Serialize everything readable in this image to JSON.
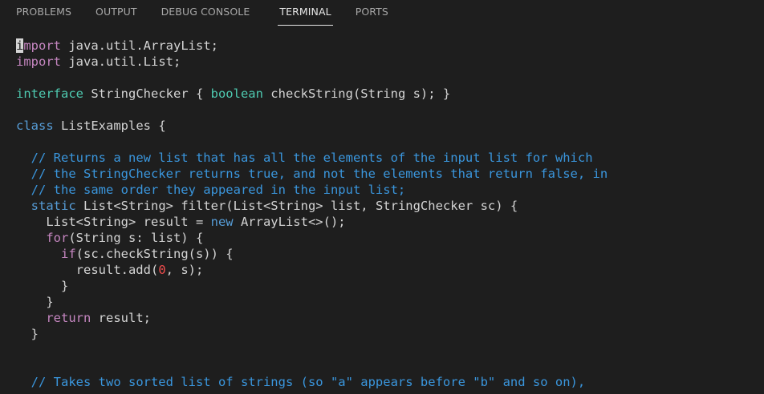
{
  "panel": {
    "tabs": [
      {
        "label": "PROBLEMS"
      },
      {
        "label": "OUTPUT"
      },
      {
        "label": "DEBUG CONSOLE"
      },
      {
        "label": "TERMINAL",
        "active": true
      },
      {
        "label": "PORTS"
      }
    ]
  },
  "colors": {
    "background": "#1e1e1e",
    "text": "#d4d4d4",
    "import_keyword": "#c586c0",
    "keyword": "#569cd6",
    "boolean_keyword": "#4ec9b0",
    "comment": "#3a96dd",
    "number": "#f14c4c"
  },
  "terminal": {
    "lines": [
      [
        {
          "t": "i",
          "c": "cursor"
        },
        {
          "t": "mport",
          "c": "kw"
        },
        {
          "t": " java.util.ArrayList;"
        }
      ],
      [
        {
          "t": "import",
          "c": "kw"
        },
        {
          "t": " java.util.List;"
        }
      ],
      [],
      [
        {
          "t": "interface",
          "c": "kw3"
        },
        {
          "t": " StringChecker { "
        },
        {
          "t": "boolean",
          "c": "kw3"
        },
        {
          "t": " checkString(String s); }"
        }
      ],
      [],
      [
        {
          "t": "class",
          "c": "kw2"
        },
        {
          "t": " ListExamples {"
        }
      ],
      [],
      [
        {
          "t": "  "
        },
        {
          "t": "// Returns a new list that has all the elements of the input list for which",
          "c": "cm"
        }
      ],
      [
        {
          "t": "  "
        },
        {
          "t": "// the StringChecker returns true, and not the elements that return false, in",
          "c": "cm"
        }
      ],
      [
        {
          "t": "  "
        },
        {
          "t": "// the same order they appeared in the input list;",
          "c": "cm"
        }
      ],
      [
        {
          "t": "  "
        },
        {
          "t": "static",
          "c": "kw2"
        },
        {
          "t": " List<String> filter(List<String> list, StringChecker sc) {"
        }
      ],
      [
        {
          "t": "    List<String> result = "
        },
        {
          "t": "new",
          "c": "kw2"
        },
        {
          "t": " ArrayList<>();"
        }
      ],
      [
        {
          "t": "    "
        },
        {
          "t": "for",
          "c": "kw"
        },
        {
          "t": "(String s: list) {"
        }
      ],
      [
        {
          "t": "      "
        },
        {
          "t": "if",
          "c": "kw"
        },
        {
          "t": "(sc.checkString(s)) {"
        }
      ],
      [
        {
          "t": "        result.add("
        },
        {
          "t": "0",
          "c": "nm"
        },
        {
          "t": ", s);"
        }
      ],
      [
        {
          "t": "      }"
        }
      ],
      [
        {
          "t": "    }"
        }
      ],
      [
        {
          "t": "    "
        },
        {
          "t": "return",
          "c": "kw"
        },
        {
          "t": " result;"
        }
      ],
      [
        {
          "t": "  }"
        }
      ],
      [],
      [],
      [
        {
          "t": "  "
        },
        {
          "t": "// Takes two sorted list of strings (so \"a\" appears before \"b\" and so on),",
          "c": "cm"
        }
      ]
    ]
  }
}
